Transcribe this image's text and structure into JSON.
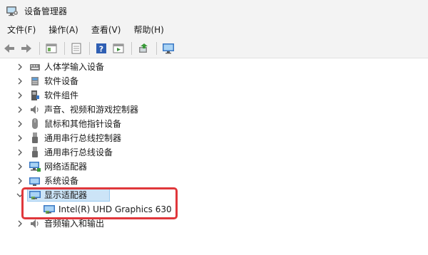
{
  "window": {
    "title": "设备管理器"
  },
  "menu": {
    "items": [
      "文件(F)",
      "操作(A)",
      "查看(V)",
      "帮助(H)"
    ]
  },
  "toolbar": {
    "buttons": [
      "back-arrow-icon",
      "forward-arrow-icon",
      "show-hide-tree-icon",
      "properties-icon",
      "help-icon",
      "run-icon",
      "update-driver-icon",
      "monitor-scan-icon"
    ]
  },
  "tree": {
    "nodes": [
      {
        "label": "人体学输入设备",
        "icon": "hid-icon",
        "expanded": false
      },
      {
        "label": "软件设备",
        "icon": "software-device-icon",
        "expanded": false
      },
      {
        "label": "软件组件",
        "icon": "software-component-icon",
        "expanded": false
      },
      {
        "label": "声音、视频和游戏控制器",
        "icon": "speaker-icon",
        "expanded": false
      },
      {
        "label": "鼠标和其他指针设备",
        "icon": "mouse-icon",
        "expanded": false
      },
      {
        "label": "通用串行总线控制器",
        "icon": "usb-icon",
        "expanded": false
      },
      {
        "label": "通用串行总线设备",
        "icon": "usb-icon",
        "expanded": false
      },
      {
        "label": "网络适配器",
        "icon": "network-icon",
        "expanded": false
      },
      {
        "label": "系统设备",
        "icon": "system-folder-icon",
        "expanded": false
      },
      {
        "label": "显示适配器",
        "icon": "display-adapter-icon",
        "expanded": true,
        "selected": true
      },
      {
        "label": "音频输入和输出",
        "icon": "audio-icon",
        "expanded": false
      }
    ],
    "child": {
      "label": "Intel(R) UHD Graphics 630",
      "icon": "display-adapter-icon"
    }
  },
  "colors": {
    "highlight": "#e0373b",
    "selection": "#cce4f7"
  }
}
